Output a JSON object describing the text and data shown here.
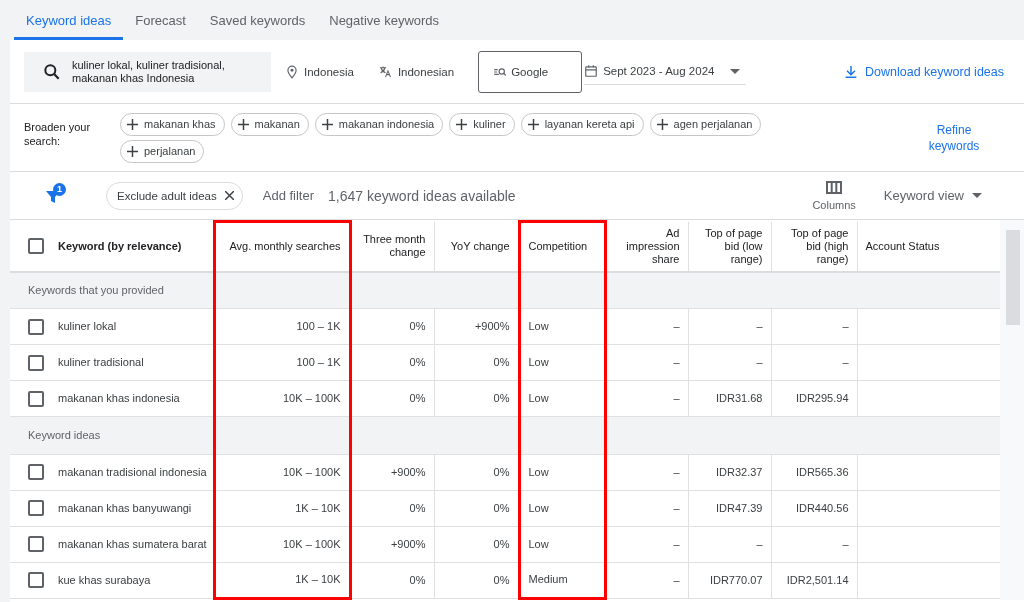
{
  "tabs": [
    {
      "label": "Keyword ideas",
      "selected": true
    },
    {
      "label": "Forecast",
      "selected": false
    },
    {
      "label": "Saved keywords",
      "selected": false
    },
    {
      "label": "Negative keywords",
      "selected": false
    }
  ],
  "search": {
    "value": "kuliner lokal, kuliner tradisional, makanan khas Indonesia",
    "location": "Indonesia",
    "language": "Indonesian",
    "network": "Google",
    "date_range": "Sept 2023 - Aug 2024",
    "download": "Download keyword ideas"
  },
  "broaden": {
    "label": "Broaden your search:",
    "chips": [
      "makanan khas",
      "makanan",
      "makanan indonesia",
      "kuliner",
      "layanan kereta api",
      "agen perjalanan",
      "perjalanan"
    ],
    "refine": "Refine keywords"
  },
  "filters": {
    "badge": "1",
    "chips": [
      "Exclude adult ideas"
    ],
    "add_filter": "Add filter",
    "count": "1,647 keyword ideas available",
    "columns": "Columns",
    "view": "Keyword view"
  },
  "table": {
    "select_all_checked": false,
    "columns": [
      {
        "label": "Keyword (by relevance)",
        "highlighted": false
      },
      {
        "label": "Avg. monthly searches",
        "highlighted": true
      },
      {
        "label": "Three month change",
        "highlighted": false
      },
      {
        "label": "YoY change",
        "highlighted": false
      },
      {
        "label": "Competition",
        "highlighted": true
      },
      {
        "label": "Ad impression share",
        "highlighted": false
      },
      {
        "label": "Top of page bid (low range)",
        "highlighted": false
      },
      {
        "label": "Top of page bid (high range)",
        "highlighted": false
      },
      {
        "label": "Account Status",
        "highlighted": false
      }
    ],
    "groups": [
      {
        "label": "Keywords that you provided",
        "rows": [
          {
            "checked": false,
            "keyword": "kuliner lokal",
            "values": [
              "100 – 1K",
              "0%",
              "+900%",
              "Low",
              "–",
              "–",
              "–"
            ]
          },
          {
            "checked": false,
            "keyword": "kuliner tradisional",
            "values": [
              "100 – 1K",
              "0%",
              "0%",
              "Low",
              "–",
              "–",
              "–"
            ]
          },
          {
            "checked": false,
            "keyword": "makanan khas indonesia",
            "values": [
              "10K – 100K",
              "0%",
              "0%",
              "Low",
              "–",
              "IDR31.68",
              "IDR295.94"
            ]
          }
        ]
      },
      {
        "label": "Keyword ideas",
        "rows": [
          {
            "checked": false,
            "keyword": "makanan tradisional indonesia",
            "values": [
              "10K – 100K",
              "+900%",
              "0%",
              "Low",
              "–",
              "IDR32.37",
              "IDR565.36"
            ]
          },
          {
            "checked": false,
            "keyword": "makanan khas banyuwangi",
            "values": [
              "1K – 10K",
              "0%",
              "0%",
              "Low",
              "–",
              "IDR47.39",
              "IDR440.56"
            ]
          },
          {
            "checked": false,
            "keyword": "makanan khas sumatera barat",
            "values": [
              "10K – 100K",
              "+900%",
              "0%",
              "Low",
              "–",
              "–",
              "–"
            ]
          },
          {
            "checked": false,
            "keyword": "kue khas surabaya",
            "values": [
              "1K – 10K",
              "0%",
              "0%",
              "Medium",
              "–",
              "IDR770.07",
              "IDR2,501.14"
            ]
          }
        ]
      }
    ]
  }
}
